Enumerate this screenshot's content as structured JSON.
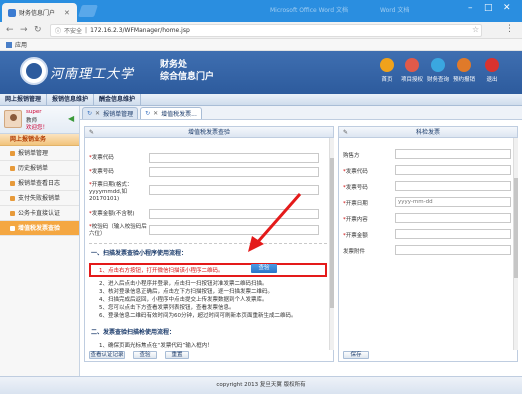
{
  "browser": {
    "tab_title": "财务信息门户",
    "window_bg_text_1": "Microsoft Office Word 文档",
    "window_bg_text_2": "Word 文档",
    "secure_label": "不安全",
    "url": "172.16.2.3/WFManager/home.jsp",
    "bookmark_label": "应用"
  },
  "header": {
    "university_name": "河南理工大学",
    "portal_line1": "财务处",
    "portal_line2": "综合信息门户",
    "nav": [
      {
        "label": "首页",
        "color": "#f0a21b"
      },
      {
        "label": "项目授权",
        "color": "#e05a4a"
      },
      {
        "label": "财务查询",
        "color": "#3aa7e0"
      },
      {
        "label": "预约报销",
        "color": "#e07a2a"
      },
      {
        "label": "退出",
        "color": "#d9332e"
      }
    ]
  },
  "menubar": {
    "items": [
      "网上报销管理",
      "报销信息维护",
      "酬金信息维护"
    ]
  },
  "sidebar": {
    "user_line1": "super",
    "user_line2": "教师",
    "user_line3": "欢迎您！",
    "section_title": "网上报销业务",
    "items": [
      {
        "label": "报销单管理"
      },
      {
        "label": "历史报销单"
      },
      {
        "label": "报销单查看日志"
      },
      {
        "label": "支付失败报销单"
      },
      {
        "label": "公务卡直接认证"
      },
      {
        "label": "增值税发票查验"
      }
    ]
  },
  "tabs": [
    {
      "label": "报销单管理"
    },
    {
      "label": "增值税发票..."
    }
  ],
  "left_panel": {
    "title": "增值税发票查验",
    "fields": [
      {
        "label": "发票代码",
        "required": "*"
      },
      {
        "label": "发票号码",
        "required": "*"
      },
      {
        "label": "开票日期(格式：yyyymmdd,如20170101)",
        "required": "*"
      },
      {
        "label": "发票金额(不含税)",
        "required": "*"
      },
      {
        "label": "校验码（输入校验码后六位）",
        "required": "*"
      }
    ],
    "section1_title": "一、扫描发票查验小程序使用流程：",
    "step1": "1、点击右方按钮，打开微信扫描该小程序二维码。",
    "query_button": "查验",
    "steps": [
      "2、进入后点击小程序并登录，点击扫一扫按钮对准发票二维码扫描。",
      "3、核对登录信息正确后，点击左下方扫描按钮，逐一扫描发票二维码。",
      "4、扫描完成后返回，小程序中点击提交上传发票数据到个人发票库。",
      "5、您可以点击下方查看发票列表按钮，查看发票信息。",
      "6、登录信息二维码有效时间为60分钟，超过时间可刷新本页面重新生成二维码。"
    ],
    "section2_title": "二、发票查验扫描枪使用流程：",
    "section2_step1": "1、确保页面光标焦点在“发票代码”输入框内！",
    "buttons": [
      "查看认证记录",
      "查验",
      "重置"
    ]
  },
  "right_panel": {
    "title": "科检发票",
    "fields": [
      {
        "label": "购售方",
        "required": ""
      },
      {
        "label": "发票代码",
        "required": "*"
      },
      {
        "label": "发票号码",
        "required": "*"
      },
      {
        "label": "开票日期",
        "required": "*"
      },
      {
        "label": "开票内容",
        "required": "*"
      },
      {
        "label": "开票金额",
        "required": "*"
      },
      {
        "label": "发票附件",
        "required": ""
      }
    ],
    "date_placeholder": "yyyy-mm-dd",
    "save_button": "保存"
  },
  "footer": {
    "copyright": "copyright 2013 复旦天翼 版权所有"
  }
}
